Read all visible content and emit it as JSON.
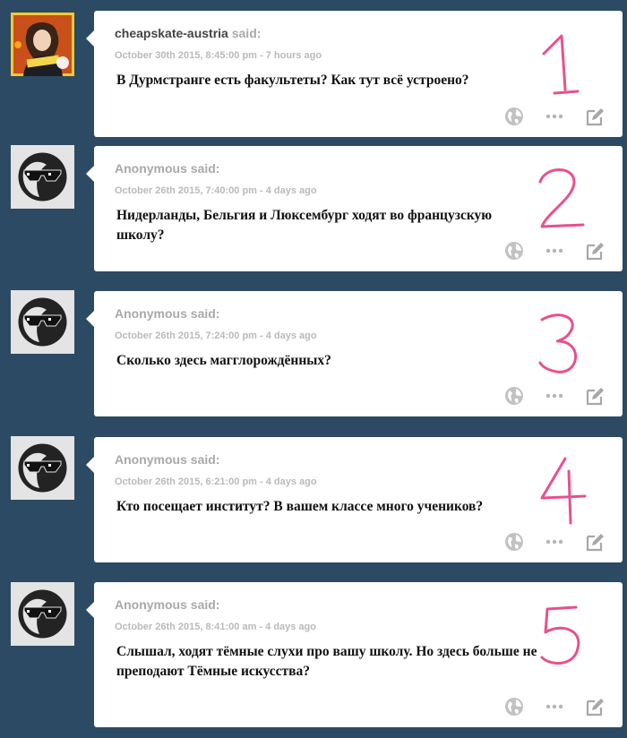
{
  "said_label": "said:",
  "posts": [
    {
      "user": "cheapskate-austria",
      "is_user": true,
      "date": "October 30th 2015, 8:45:00 pm",
      "relative": "7 hours ago",
      "question": "В Дурмстранге есть факультеты? Как тут всё устроено?",
      "number": "1"
    },
    {
      "user": "Anonymous",
      "is_user": false,
      "date": "October 26th 2015, 7:40:00 pm",
      "relative": "4 days ago",
      "question": "Нидерланды, Бельгия и Люксембург ходят во французскую школу?",
      "number": "2"
    },
    {
      "user": "Anonymous",
      "is_user": false,
      "date": "October 26th 2015, 7:24:00 pm",
      "relative": "4 days ago",
      "question": "Сколько здесь магглорождённых?",
      "number": "3"
    },
    {
      "user": "Anonymous",
      "is_user": false,
      "date": "October 26th 2015, 6:21:00 pm",
      "relative": "4 days ago",
      "question": "Кто посещает институт? В вашем классе много учеников?",
      "number": "4"
    },
    {
      "user": "Anonymous",
      "is_user": false,
      "date": "October 26th 2015, 8:41:00 am",
      "relative": "4 days ago",
      "question": "Слышал, ходят тёмные слухи про вашу школу. Но здесь больше не преподают Тёмные искусства?",
      "number": "5"
    }
  ],
  "accent_color": "#e8508f",
  "background_color": "#2c4a63",
  "icons": [
    "globe-icon",
    "more-icon",
    "edit-icon"
  ]
}
